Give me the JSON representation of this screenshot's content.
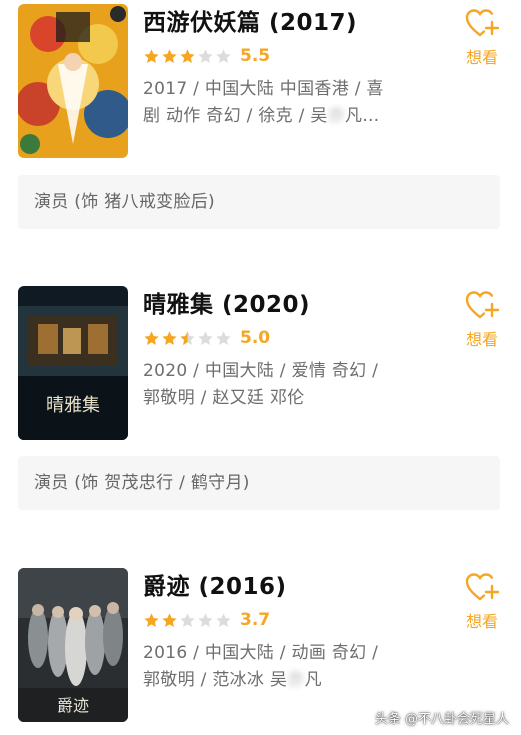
{
  "colors": {
    "accent": "#f5a623",
    "star_empty": "#dcdcdc",
    "card_bg": "#f6f6f6"
  },
  "movies": [
    {
      "title": "西游伏妖篇 (2017)",
      "rating": "5.5",
      "stars": 3,
      "meta_line1": "2017 / 中国大陆 中国香港 / 喜",
      "meta_line2": "剧 动作 奇幻 / 徐克 / 吴",
      "meta_blur": "亦",
      "meta_tail": "凡…",
      "want_label": "想看",
      "role": "演员 (饰 猪八戒变脸后)"
    },
    {
      "title": "晴雅集 (2020)",
      "rating": "5.0",
      "stars": 2.5,
      "meta_line1": "2020 / 中国大陆 / 爱情 奇幻 /",
      "meta_line2": "郭敬明 / 赵又廷 邓伦",
      "want_label": "想看",
      "role": "演员 (饰 贺茂忠行 / 鹤守月)"
    },
    {
      "title": "爵迹 (2016)",
      "rating": "3.7",
      "stars": 2,
      "meta_line1": "2016 / 中国大陆 / 动画 奇幻 /",
      "meta_line2": "郭敬明 / 范冰冰 吴",
      "meta_blur": "亦",
      "meta_tail": "凡",
      "want_label": "想看"
    }
  ],
  "watermark": "头条 @不八卦会死星人"
}
